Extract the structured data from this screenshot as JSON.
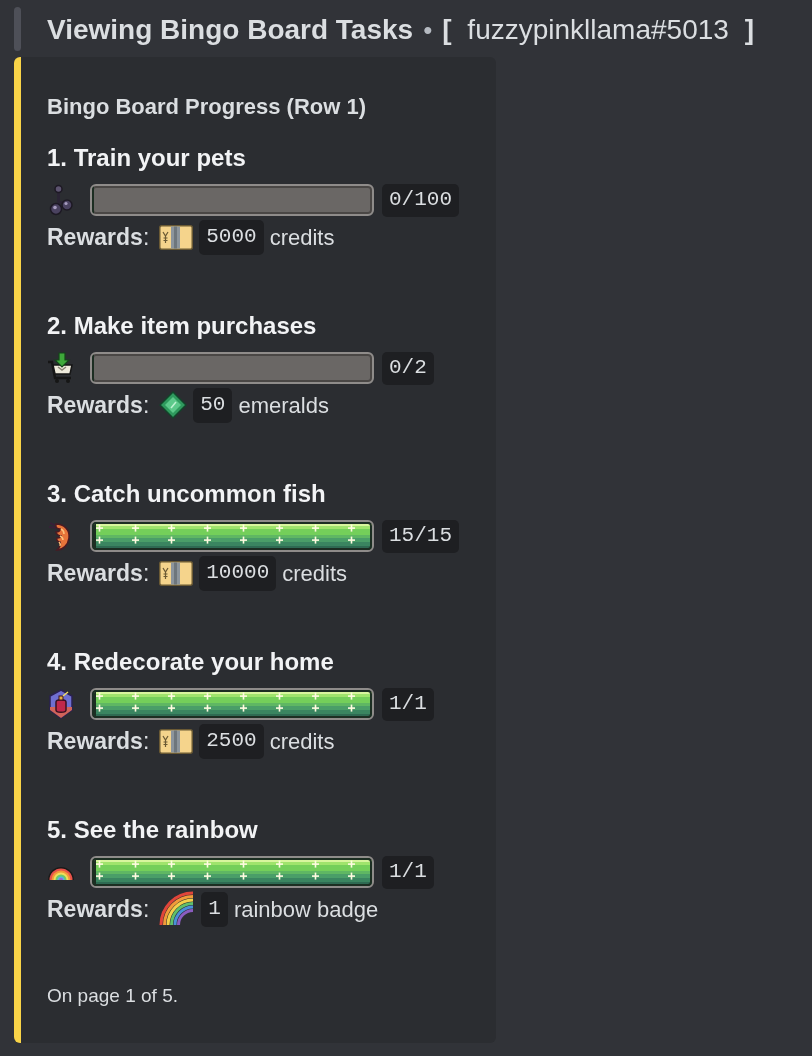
{
  "header": {
    "title": "Viewing Bingo Board Tasks",
    "separator": "•",
    "user": "**[** fuzzypinkllama#5013 **]**"
  },
  "embed": {
    "title": "Bingo Board Progress (Row 1)",
    "tasks": [
      {
        "title": "1. Train your pets",
        "level": 0,
        "count": "0/100",
        "reward": {
          "label": "**Rewards**:",
          "kind": "credits",
          "amount": "5000",
          "unit": "credits"
        }
      },
      {
        "title": "2. Make item purchases",
        "level": 0,
        "count": "0/2",
        "reward": {
          "label": "**Rewards**:",
          "kind": "emeralds",
          "amount": "50",
          "unit": "emeralds"
        }
      },
      {
        "title": "3. Catch uncommon fish",
        "level": 1,
        "count": "15/15",
        "reward": {
          "label": "**Rewards**:",
          "kind": "credits",
          "amount": "10000",
          "unit": "credits"
        }
      },
      {
        "title": "4. Redecorate your home",
        "level": 1,
        "count": "1/1",
        "reward": {
          "label": "**Rewards**:",
          "kind": "credits",
          "amount": "2500",
          "unit": "credits"
        }
      },
      {
        "title": "5. See the rainbow",
        "level": 1,
        "count": "1/1",
        "reward": {
          "label": "**Rewards**:",
          "kind": "badge",
          "amount": "1",
          "unit": "rainbow badge"
        }
      }
    ],
    "footer": "On page 1 of 5."
  }
}
